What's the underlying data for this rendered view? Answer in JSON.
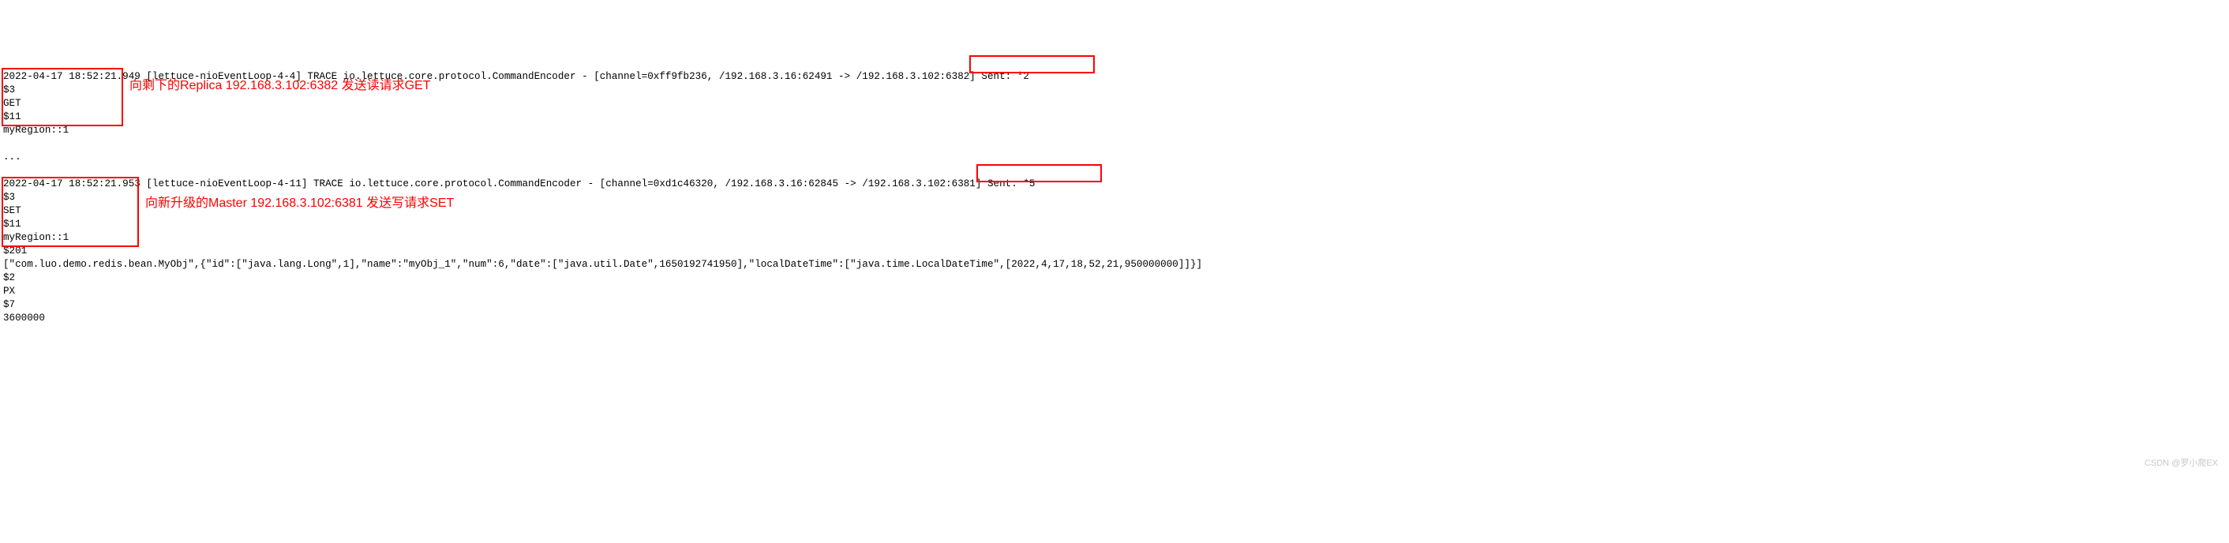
{
  "log1": {
    "line1": "2022-04-17 18:52:21.949 [lettuce-nioEventLoop-4-4] TRACE io.lettuce.core.protocol.CommandEncoder - [channel=0xff9fb236, /192.168.3.16:62491 -> /192.168.3.102:6382] Sent: *2",
    "line2": "$3",
    "line3": "GET",
    "line4": "$11",
    "line5": "myRegion::1"
  },
  "annotation1": "向剩下的Replica 192.168.3.102:6382 发送读请求GET",
  "separator": "...",
  "log2": {
    "line1": "2022-04-17 18:52:21.953 [lettuce-nioEventLoop-4-11] TRACE io.lettuce.core.protocol.CommandEncoder - [channel=0xd1c46320, /192.168.3.16:62845 -> /192.168.3.102:6381] Sent: *5",
    "line2": "$3",
    "line3": "SET",
    "line4": "$11",
    "line5": "myRegion::1",
    "line6": "$201",
    "line7": "[\"com.luo.demo.redis.bean.MyObj\",{\"id\":[\"java.lang.Long\",1],\"name\":\"myObj_1\",\"num\":6,\"date\":[\"java.util.Date\",1650192741950],\"localDateTime\":[\"java.time.LocalDateTime\",[2022,4,17,18,52,21,950000000]]}]",
    "line8": "$2",
    "line9": "PX",
    "line10": "$7",
    "line11": "3600000"
  },
  "annotation2": "向新升级的Master 192.168.3.102:6381 发送写请求SET",
  "watermark": "CSDN @罗小爬EX"
}
